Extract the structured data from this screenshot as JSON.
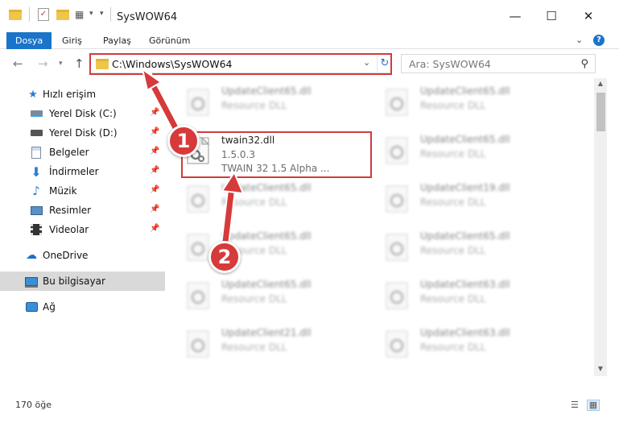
{
  "window": {
    "title": "SysWOW64",
    "minimize": "—",
    "maximize": "☐",
    "close": "✕"
  },
  "ribbon": {
    "tabs": [
      "Dosya",
      "Giriş",
      "Paylaş",
      "Görünüm"
    ]
  },
  "address": {
    "path": "C:\\Windows\\SysWOW64",
    "search_placeholder": "Ara: SysWOW64"
  },
  "sidebar": {
    "items": [
      {
        "label": "Hızlı erişim",
        "icon": "star-icon"
      },
      {
        "label": "Yerel Disk (C:)",
        "icon": "drive-icon"
      },
      {
        "label": "Yerel Disk (D:)",
        "icon": "drive-icon"
      },
      {
        "label": "Belgeler",
        "icon": "documents-icon"
      },
      {
        "label": "İndirmeler",
        "icon": "downloads-icon"
      },
      {
        "label": "Müzik",
        "icon": "music-icon"
      },
      {
        "label": "Resimler",
        "icon": "pictures-icon"
      },
      {
        "label": "Videolar",
        "icon": "videos-icon"
      },
      {
        "label": "OneDrive",
        "icon": "cloud-icon"
      },
      {
        "label": "Bu bilgisayar",
        "icon": "computer-icon"
      },
      {
        "label": "Ağ",
        "icon": "network-icon"
      }
    ]
  },
  "files": {
    "focused": {
      "name": "twain32.dll",
      "version": "1.5.0.3",
      "description": "TWAIN 32 1.5 Alpha ..."
    },
    "left_column": [
      {
        "name": "UpdateClient65.dll",
        "type": "Resource DLL"
      },
      {
        "name": "UpdateClient65.dll",
        "type": "Resource DLL"
      },
      {
        "name": "UpdateClient65.dll",
        "type": "Resource DLL"
      },
      {
        "name": "UpdateClient65.dll",
        "type": "Resource DLL"
      },
      {
        "name": "UpdateClient21.dll",
        "type": "Resource DLL"
      }
    ],
    "right_column": [
      {
        "name": "UpdateClient65.dll",
        "type": "Resource DLL"
      },
      {
        "name": "UpdateClient65.dll",
        "type": "Resource DLL"
      },
      {
        "name": "UpdateClient19.dll",
        "type": "Resource DLL"
      },
      {
        "name": "UpdateClient65.dll",
        "type": "Resource DLL"
      },
      {
        "name": "UpdateClient63.dll",
        "type": "Resource DLL"
      },
      {
        "name": "UpdateClient63.dll",
        "type": "Resource DLL"
      }
    ]
  },
  "status": {
    "item_count": "170 öğe"
  },
  "annotations": {
    "step1": "1",
    "step2": "2"
  },
  "colors": {
    "accent": "#1a74c9",
    "highlight": "#d23b3b",
    "badge": "#d63a3a"
  }
}
